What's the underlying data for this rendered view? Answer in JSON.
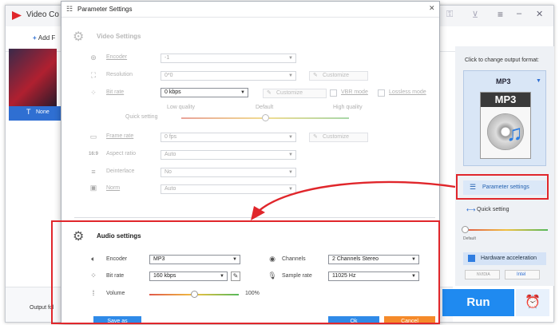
{
  "main_window": {
    "title": "Video Co",
    "add_button": "Add F",
    "subtitle_value": "None",
    "output_label": "Output fol",
    "run_label": "Run"
  },
  "right_panel": {
    "hint": "Click to change output format:",
    "format": "MP3",
    "card_label": "MP3",
    "param_settings": "Parameter settings",
    "quick_setting": "Quick setting",
    "default_label": "Default",
    "hw_accel": "Hardware acceleration",
    "nvidia": "NVIDIA",
    "intel": "Intel"
  },
  "dialog": {
    "title": "Parameter Settings",
    "video": {
      "heading": "Video Settings",
      "encoder_label": "Encoder",
      "encoder_value": "-1",
      "resolution_label": "Resolution",
      "resolution_value": "0*0",
      "resolution_customize": "Customize",
      "bitrate_label": "Bit rate",
      "bitrate_value": "0 kbps",
      "bitrate_customize": "Customize",
      "vbr_label": "VBR mode",
      "lossless_label": "Lossless mode",
      "quick_setting_label": "Quick setting",
      "quality_low": "Low quality",
      "quality_default": "Default",
      "quality_high": "High quality",
      "quality_level": 0.5,
      "framerate_label": "Frame rate",
      "framerate_value": "0 fps",
      "framerate_customize": "Customize",
      "aspect_label": "Aspect ratio",
      "aspect_value": "Auto",
      "deinterlace_label": "Deinterlace",
      "deinterlace_value": "No",
      "norm_label": "Norm",
      "norm_value": "Auto"
    },
    "audio": {
      "heading": "Audio settings",
      "encoder_label": "Encoder",
      "encoder_value": "MP3",
      "channels_label": "Channels",
      "channels_value": "2 Channels Stereo",
      "bitrate_label": "Bit rate",
      "bitrate_value": "160 kbps",
      "samplerate_label": "Sample rate",
      "samplerate_value": "11025 Hz",
      "volume_label": "Volume",
      "volume_value": "100%",
      "volume_level": 0.5
    },
    "buttons": {
      "save_as": "Save as",
      "ok": "Ok",
      "cancel": "Cancel"
    }
  },
  "colors": {
    "accent_blue": "#1f8af0",
    "highlight_red": "#e0262b",
    "cancel_orange": "#f58a2a",
    "slider_left": "#e05a4a",
    "slider_right": "#56b95a"
  }
}
